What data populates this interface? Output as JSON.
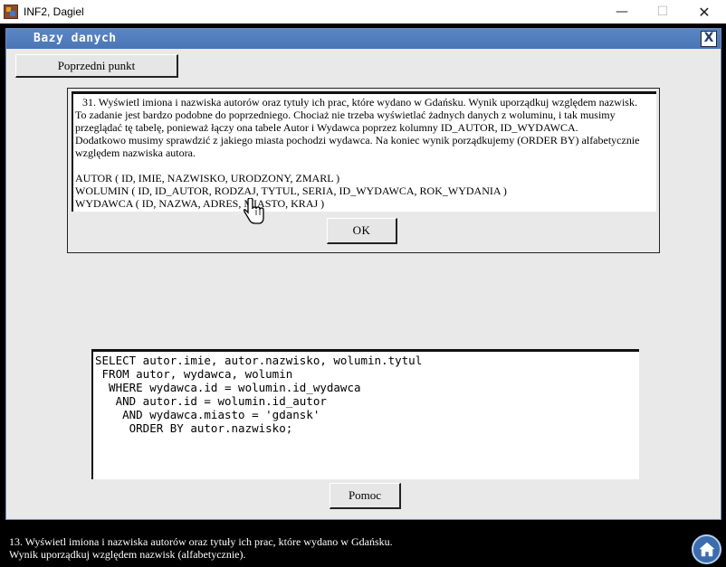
{
  "window": {
    "title": "INF2, Dagiel",
    "minimize_glyph": "—",
    "maximize_glyph": "☐",
    "close_glyph": "✕"
  },
  "dialog": {
    "title": "Bazy danych",
    "close_glyph": "X",
    "prev_button": "Poprzedni punkt",
    "task": {
      "lines": [
        "31. Wyświetl imiona i nazwiska autorów oraz tytuły ich prac, które wydano w Gdańsku. Wynik uporządkuj względem nazwisk.",
        "To zadanie jest bardzo podobne do poprzedniego. Chociaż nie trzeba wyświetlać żadnych danych z woluminu, i tak musimy przeglądać tę tabelę, ponieważ łączy ona tabele Autor i Wydawca poprzez kolumny ID_AUTOR, ID_WYDAWCA.",
        "Dodatkowo musimy sprawdzić z jakiego miasta pochodzi wydawca. Na koniec wynik porządkujemy (ORDER BY) alfabetycznie względem nazwiska autora."
      ],
      "schema": [
        "AUTOR ( ID, IMIE, NAZWISKO, URODZONY, ZMARL )",
        "WOLUMIN ( ID, ID_AUTOR, RODZAJ, TYTUL, SERIA, ID_WYDAWCA, ROK_WYDANIA )",
        "WYDAWCA ( ID, NAZWA, ADRES, MIASTO, KRAJ )"
      ]
    },
    "ok_button": "OK",
    "sql_lines": [
      "SELECT autor.imie, autor.nazwisko, wolumin.tytul",
      " FROM autor, wydawca, wolumin",
      "  WHERE wydawca.id = wolumin.id_wydawca",
      "   AND autor.id = wolumin.id_autor",
      "    AND wydawca.miasto = 'gdansk'",
      "     ORDER BY autor.nazwisko;"
    ],
    "help_button": "Pomoc"
  },
  "footer": {
    "line1": "13. Wyświetl imiona i nazwiska autorów oraz tytuły ich prac, które wydano w Gdańsku.",
    "line2": "Wynik uporządkuj względem nazwisk (alfabetycznie)."
  },
  "icons": {
    "app": "app-icon",
    "cursor": "hand-pointer-icon",
    "home": "home-icon"
  }
}
